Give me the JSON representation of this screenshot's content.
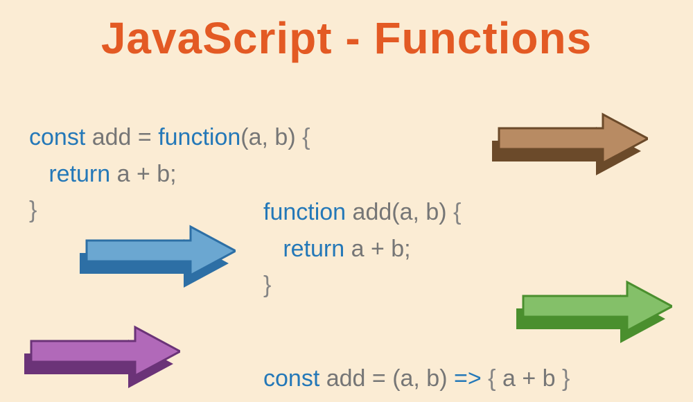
{
  "title": "JavaScript - Functions",
  "snippets": {
    "expr": {
      "l1a": "const",
      "l1b": " add = ",
      "l1c": "function",
      "l1d": "(a, b) ",
      "l1e": "{",
      "l2a": "   return",
      "l2b": " a + b;",
      "l3a": "}"
    },
    "decl": {
      "l1a": "function",
      "l1b": " add(a, b) ",
      "l1c": "{",
      "l2a": "   return",
      "l2b": " a + b;",
      "l3a": "}"
    },
    "arrow": {
      "l1a": "const",
      "l1b": " add = (a, b) ",
      "l1c": "=>",
      "l1d": " ",
      "l1e": "{",
      "l1f": " a + b ",
      "l1g": "}"
    }
  },
  "arrows": {
    "brown": {
      "light": "#b88b63",
      "dark": "#6b4a2a"
    },
    "blue": {
      "light": "#6ba7d1",
      "dark": "#2d6fa5"
    },
    "green": {
      "light": "#84c069",
      "dark": "#4a8f2e"
    },
    "purple": {
      "light": "#b169b9",
      "dark": "#6b3378"
    }
  }
}
